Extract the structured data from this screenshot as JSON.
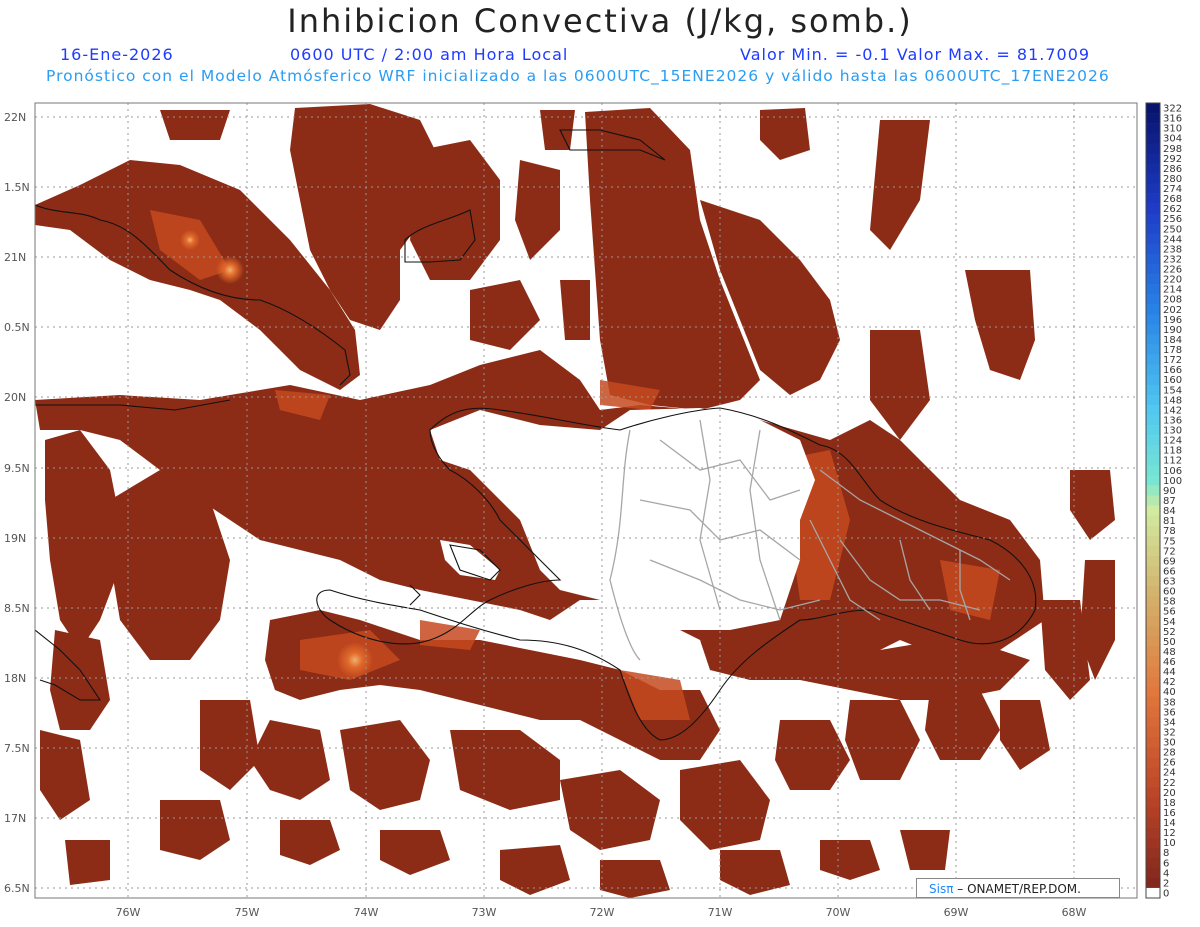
{
  "header": {
    "title": "Inhibicion Convectiva (J/kg, somb.)",
    "date": "16-Ene-2026",
    "time": "0600 UTC / 2:00 am Hora Local",
    "minmax": "Valor Min. = -0.1  Valor Max. = 81.7009",
    "forecast": "Pronóstico con el Modelo Atmósferico WRF inicializado a las 0600UTC_15ENE2026 y válido hasta las  0600UTC_17ENE2026"
  },
  "map": {
    "lat_labels": [
      "22N",
      "1.5N",
      "21N",
      "0.5N",
      "20N",
      "9.5N",
      "19N",
      "8.5N",
      "18N",
      "7.5N",
      "17N",
      "6.5N"
    ],
    "lon_labels": [
      "76W",
      "75W",
      "74W",
      "73W",
      "72W",
      "71W",
      "70W",
      "69W",
      "68W"
    ],
    "field_color": "#8a2a14",
    "warm_color": "#e0692a"
  },
  "colorbar": {
    "labels": [
      "322",
      "316",
      "310",
      "304",
      "298",
      "292",
      "286",
      "280",
      "274",
      "268",
      "262",
      "256",
      "250",
      "244",
      "238",
      "232",
      "226",
      "220",
      "214",
      "208",
      "202",
      "196",
      "190",
      "184",
      "178",
      "172",
      "166",
      "160",
      "154",
      "148",
      "142",
      "136",
      "130",
      "124",
      "118",
      "112",
      "106",
      "100",
      "90",
      "87",
      "84",
      "81",
      "78",
      "75",
      "72",
      "69",
      "66",
      "63",
      "60",
      "58",
      "56",
      "54",
      "52",
      "50",
      "48",
      "46",
      "44",
      "42",
      "40",
      "38",
      "36",
      "34",
      "32",
      "30",
      "28",
      "26",
      "24",
      "22",
      "20",
      "18",
      "16",
      "14",
      "12",
      "10",
      "8",
      "6",
      "4",
      "2",
      "0"
    ]
  },
  "credit": {
    "sis": "Sisπ",
    "text": "– ONAMET/REP.DOM."
  }
}
